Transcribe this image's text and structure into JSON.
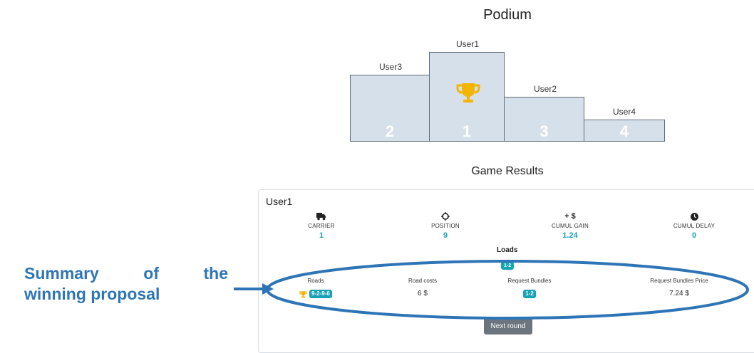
{
  "podium": {
    "title": "Podium",
    "places": [
      {
        "user": "User3",
        "rank": "2"
      },
      {
        "user": "User1",
        "rank": "1"
      },
      {
        "user": "User2",
        "rank": "3"
      },
      {
        "user": "User4",
        "rank": "4"
      }
    ],
    "winner_icon": "trophy-icon",
    "trophy_color": "#f4b400"
  },
  "results": {
    "title": "Game Results",
    "card_title": "User1",
    "stats": [
      {
        "icon": "truck-icon",
        "label": "CARRIER",
        "value": "1"
      },
      {
        "icon": "crosshair-icon",
        "label": "POSITION",
        "value": "9"
      },
      {
        "icon_text": "+ $",
        "label": "CUMUL GAIN",
        "value": "1.24"
      },
      {
        "icon": "clock-icon",
        "label": "CUMUL DELAY",
        "value": "0"
      }
    ],
    "loads": {
      "title": "Loads",
      "badge": "1-2",
      "columns": [
        "Roads",
        "Road costs",
        "Request Bundles",
        "Request Bundles Price"
      ],
      "row": {
        "roads": "9-2-9-6",
        "road_costs": "6 $",
        "request_bundles": "1-2",
        "request_bundles_price": "7.24 $"
      }
    },
    "next_button": "Next round"
  },
  "annotation": {
    "word1": "Summary",
    "word2": "of",
    "word3": "the",
    "line2": "winning proposal",
    "color": "#2e75b6"
  },
  "accent_color": "#17a2b8"
}
